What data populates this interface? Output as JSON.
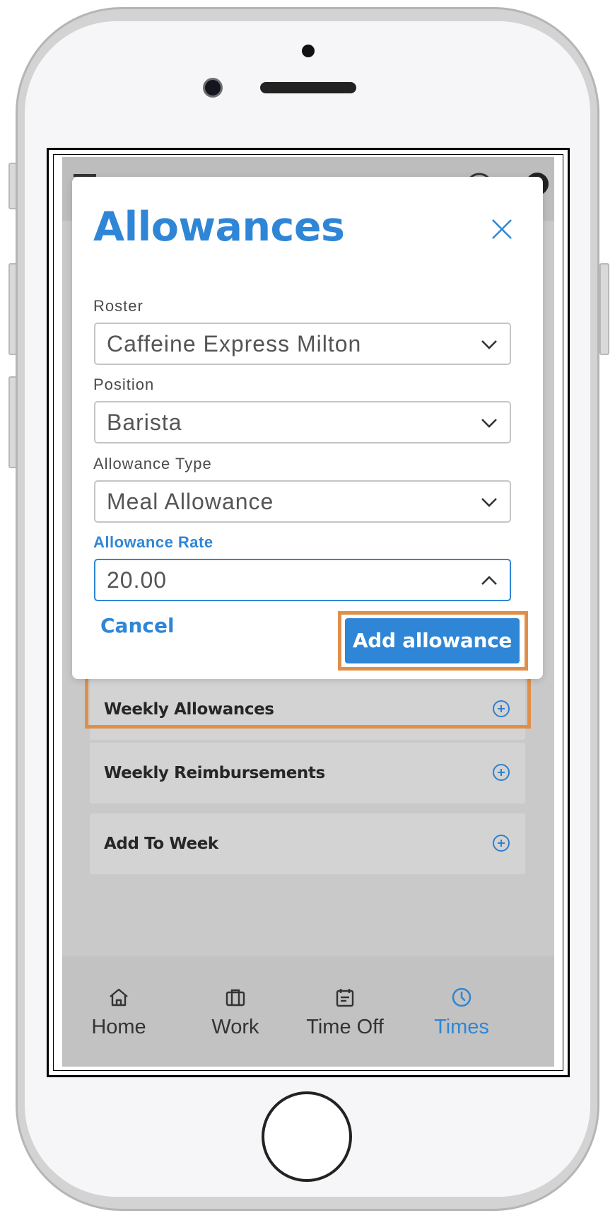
{
  "modal": {
    "title": "Allowances",
    "fields": [
      {
        "label": "Roster",
        "value": "Caffeine Express Milton"
      },
      {
        "label": "Position",
        "value": "Barista"
      },
      {
        "label": "Allowance Type",
        "value": "Meal Allowance"
      },
      {
        "label": "Allowance Rate",
        "value": "20.00"
      }
    ],
    "cancel_label": "Cancel",
    "add_label": "Add allowance"
  },
  "background": {
    "cards": [
      {
        "label": "Weekly Allowances"
      },
      {
        "label": "Weekly Reimbursements"
      },
      {
        "label": "Add To Week"
      }
    ]
  },
  "nav": {
    "items": [
      {
        "label": "Home",
        "icon": "home-icon"
      },
      {
        "label": "Work",
        "icon": "briefcase-icon"
      },
      {
        "label": "Time Off",
        "icon": "calendar-icon"
      },
      {
        "label": "Times",
        "icon": "clock-icon",
        "active": true
      }
    ]
  },
  "colors": {
    "accent": "#2f86d6",
    "highlight": "#e08f4a",
    "overlay": "#c9c9c9"
  }
}
